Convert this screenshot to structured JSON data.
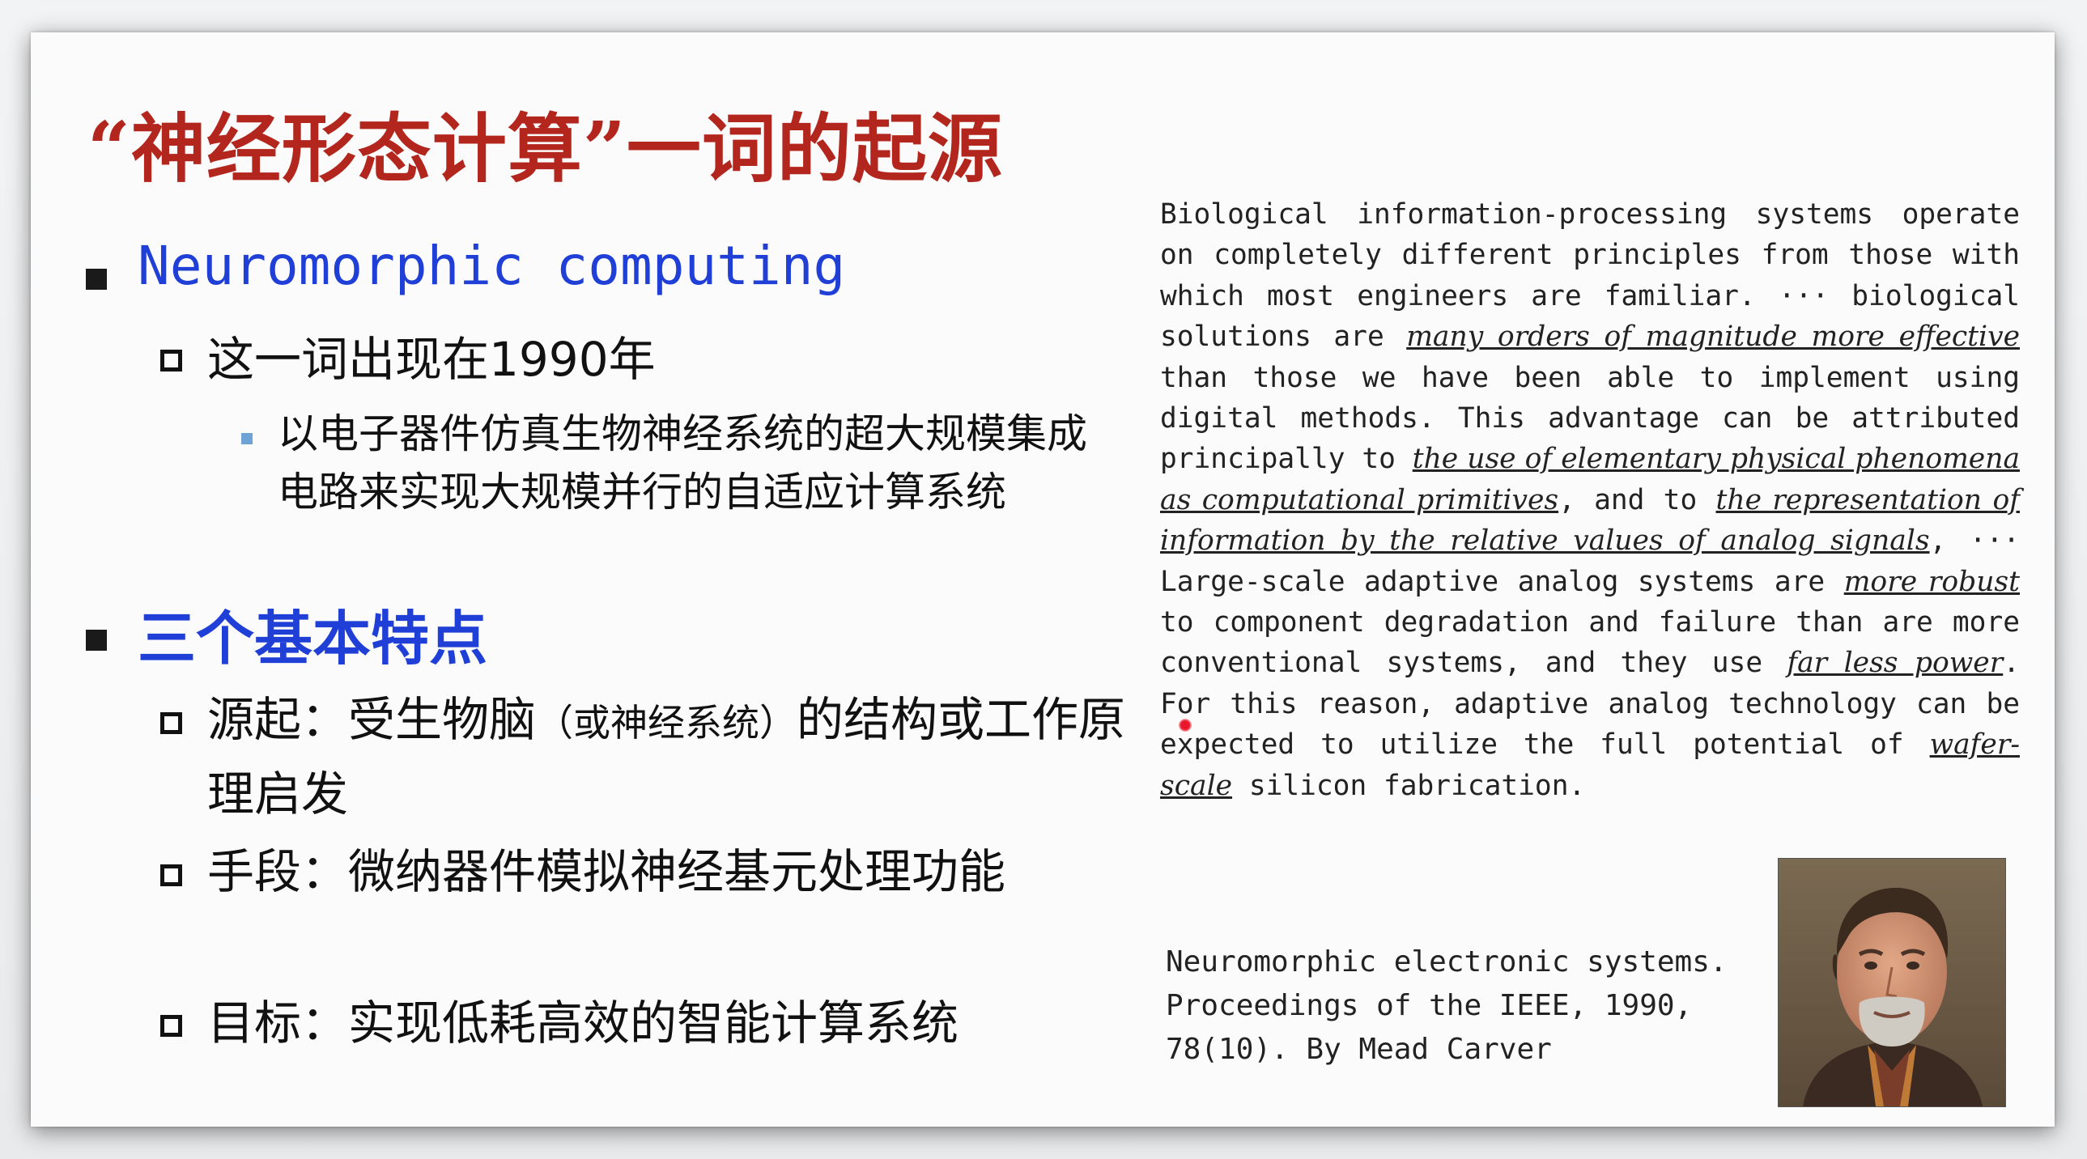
{
  "slide": {
    "title": "“神经形态计算”一词的起源",
    "section1": {
      "heading": "Neuromorphic computing",
      "sub1": "这一词出现在1990年",
      "sub1_detail": "以电子器件仿真生物神经系统的超大规模集成电路来实现大规模并行的自适应计算系统"
    },
    "section2": {
      "heading": "三个基本特点",
      "item1_main": "源起：受生物脑",
      "item1_paren": "（或神经系统）",
      "item1_tail": "的结构或工作原理启发",
      "item2": "手段：微纳器件模拟神经基元处理功能",
      "item3": "目标：实现低耗高效的智能计算系统"
    },
    "quote": {
      "p1": "Biological information-processing systems operate on completely different principles from those with which most engineers are familiar. ··· biological solutions are ",
      "h1": "many orders of magnitude more effective",
      "p2": " than those we have been able to implement using digital methods. This advantage can be attributed principally to ",
      "h2": "the use of elementary physical phenomena as computational primitives",
      "p3": ", and to ",
      "h3": "the representation of information by the relative values of analog signals",
      "p4": ", ··· Large-scale adaptive analog systems are ",
      "h4": "more robust",
      "p5": " to component degradation and failure than are more conventional systems, and they use ",
      "h5": "far less power",
      "p6": ". For this reason, adaptive analog technology can be expected to utilize the full potential of ",
      "h6": "wafer-scale",
      "p7": " silicon fabrication."
    },
    "citation": {
      "line1": "Neuromorphic electronic systems.",
      "line2": "Proceedings of the IEEE, 1990,",
      "line3": "78(10). By Mead Carver"
    },
    "colors": {
      "title": "#b3261e",
      "heading": "#1f3fd6",
      "body": "#111111"
    }
  }
}
